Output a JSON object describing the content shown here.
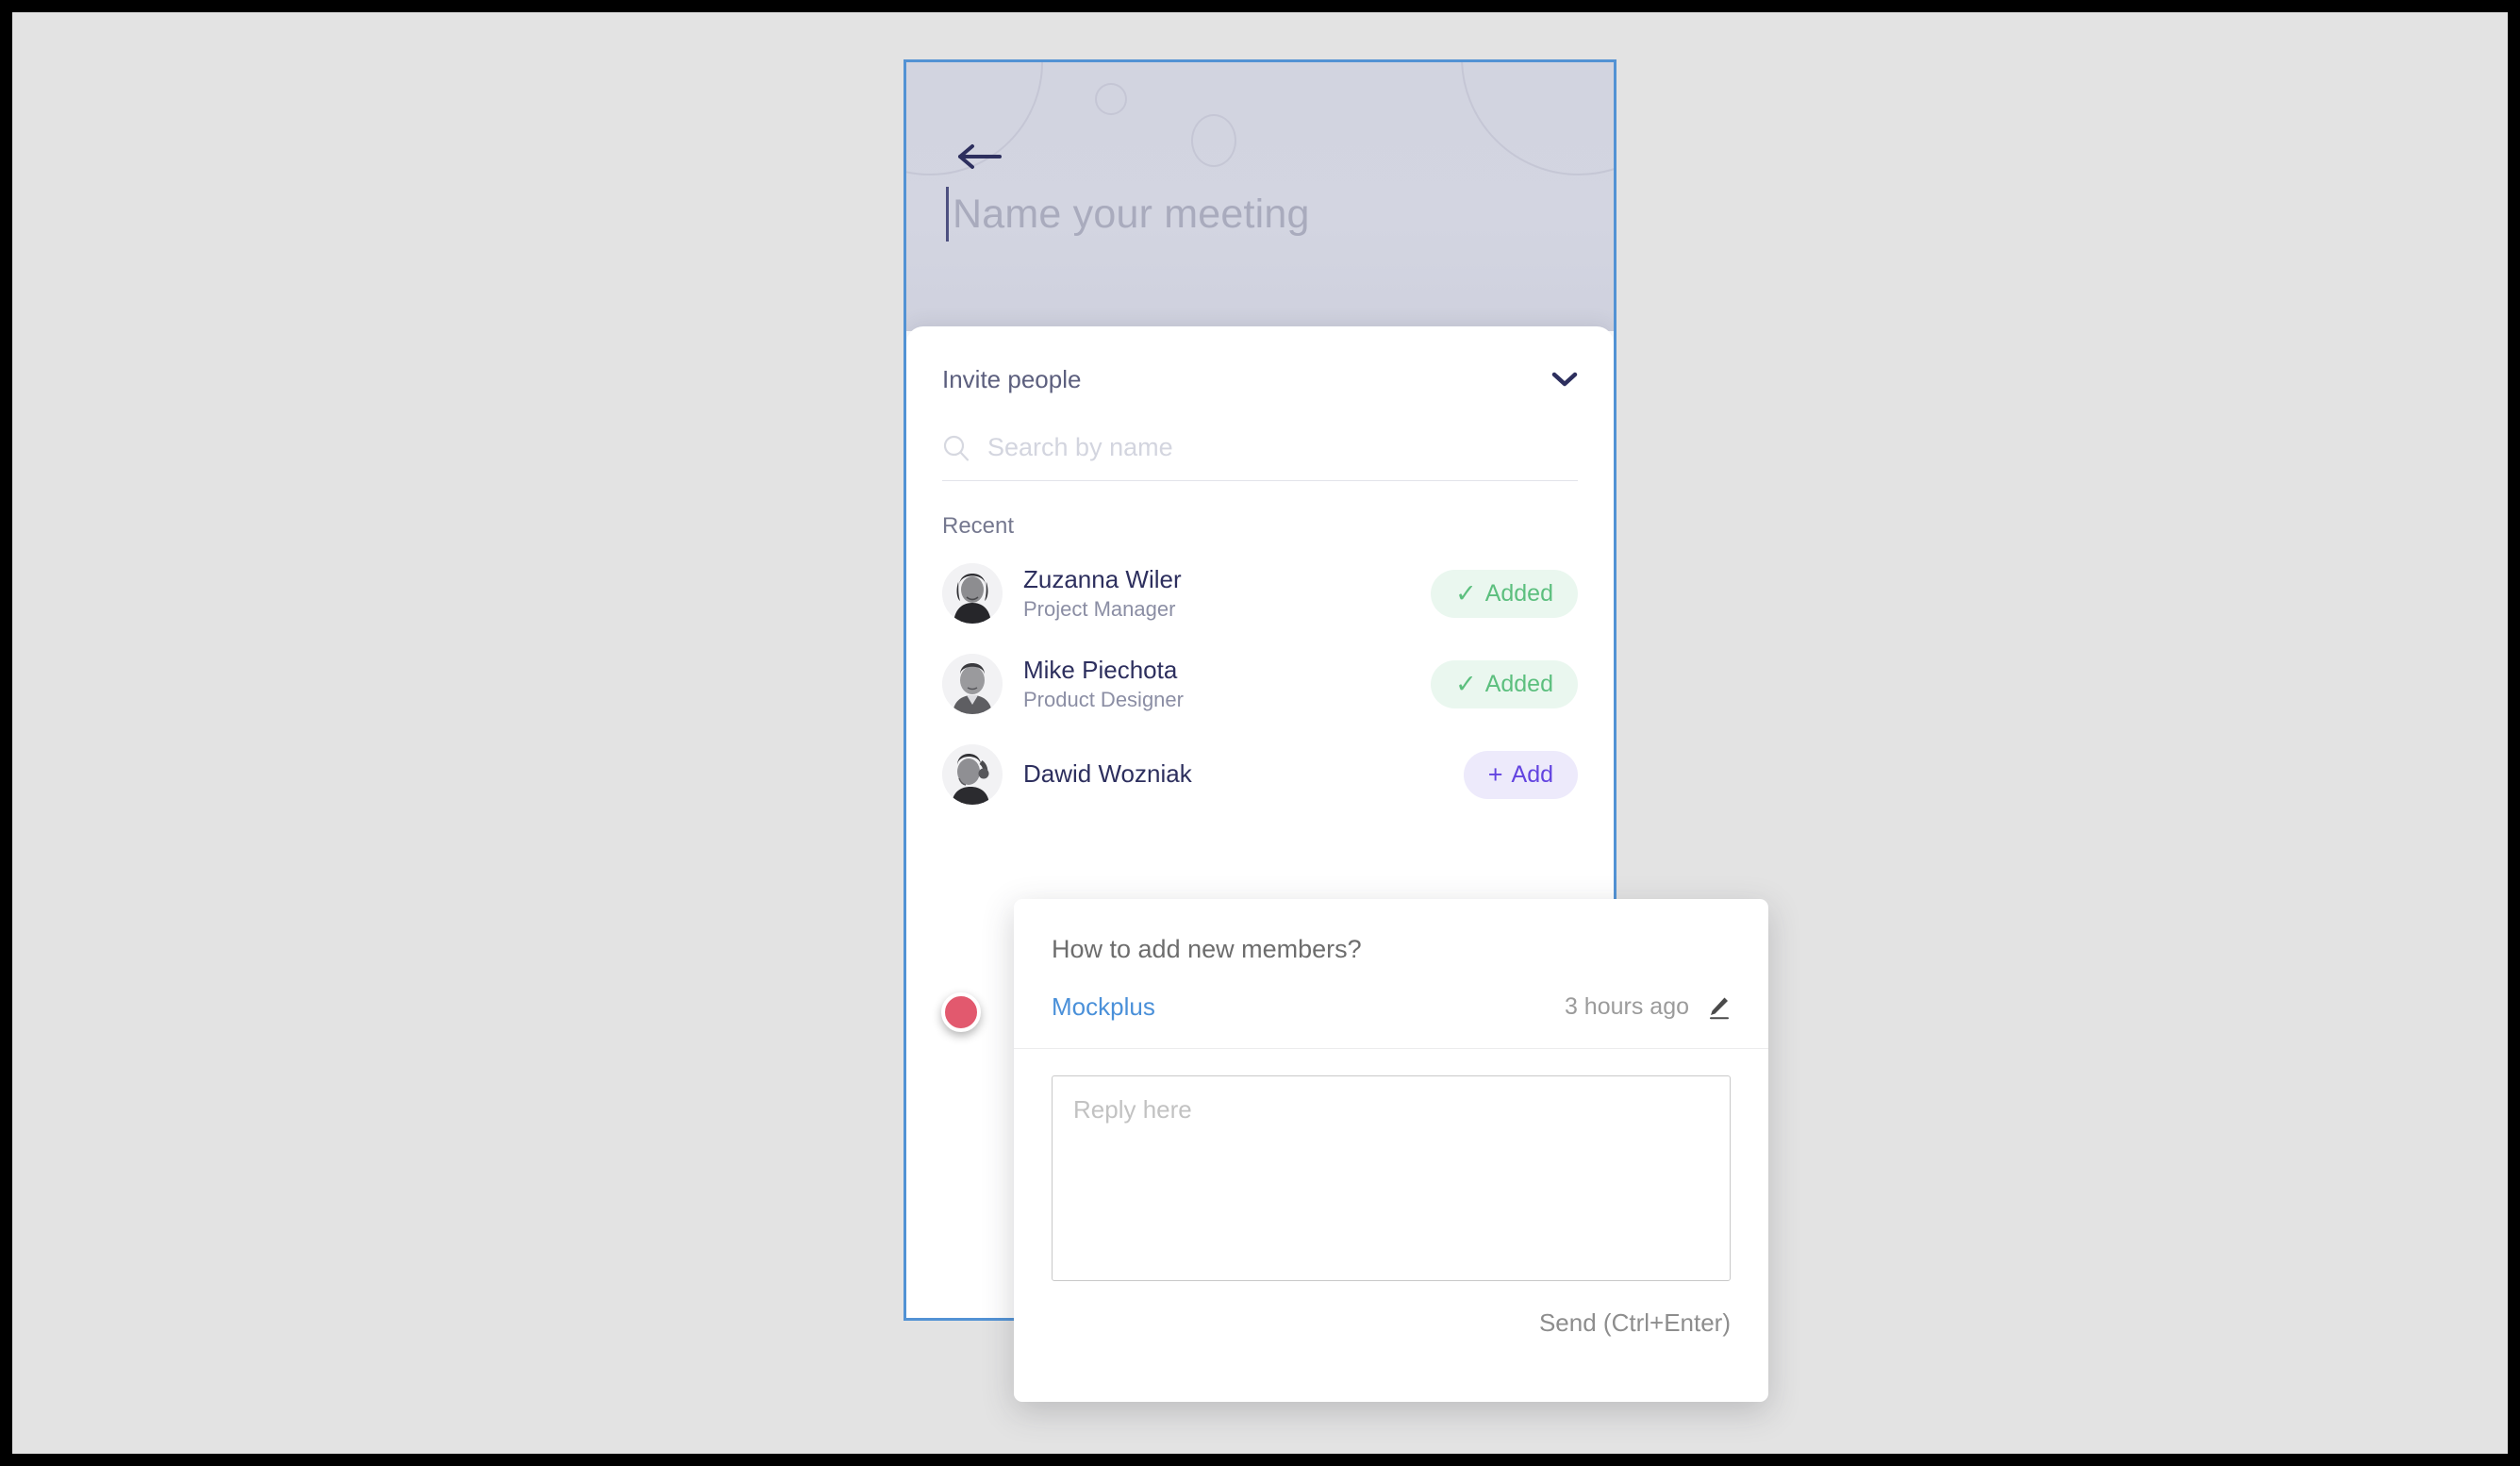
{
  "header": {
    "back_icon": "arrow-left-icon",
    "meeting_title_placeholder": "Name your meeting"
  },
  "sheet": {
    "invite_label": "Invite people",
    "chevron_icon": "chevron-down-icon",
    "search": {
      "icon": "search-icon",
      "placeholder": "Search by name",
      "value": ""
    },
    "recent_label": "Recent",
    "people": [
      {
        "name": "Zuzanna Wiler",
        "role": "Project Manager",
        "action_label": "Added",
        "action_state": "added",
        "action_glyph": "✓"
      },
      {
        "name": "Mike Piechota",
        "role": "Product Designer",
        "action_label": "Added",
        "action_state": "added",
        "action_glyph": "✓"
      },
      {
        "name": "Dawid Wozniak",
        "role": "",
        "action_label": "Add",
        "action_state": "add",
        "action_glyph": "+"
      }
    ]
  },
  "marker": {
    "name": "comment-marker",
    "color": "#e2596e"
  },
  "popup": {
    "question": "How to add new members?",
    "author": "Mockplus",
    "time": "3 hours ago",
    "edit_icon": "pencil-icon",
    "reply_placeholder": "Reply here",
    "reply_value": "",
    "send_label": "Send (Ctrl+Enter)"
  },
  "colors": {
    "frame_border": "#5292d4",
    "header_bg": "#d3d5e1",
    "navy": "#2d2f5e",
    "added_bg": "#eaf7ef",
    "added_text": "#5cbf7e",
    "add_bg": "#edeafb",
    "add_text": "#6344e0",
    "link_blue": "#4a90d9",
    "canvas": "#e3e3e3"
  }
}
